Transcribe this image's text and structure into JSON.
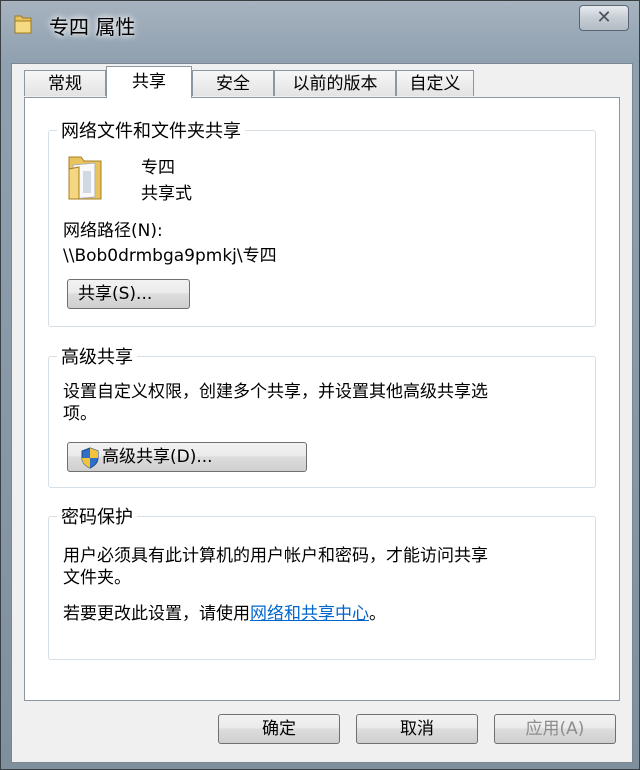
{
  "window": {
    "title": "专四 属性",
    "close_glyph": "✕"
  },
  "tabs": [
    {
      "label": "常规"
    },
    {
      "label": "共享"
    },
    {
      "label": "安全"
    },
    {
      "label": "以前的版本"
    },
    {
      "label": "自定义"
    }
  ],
  "network_sharing": {
    "group_title": "网络文件和文件夹共享",
    "folder_name": "专四",
    "status": "共享式",
    "path_label": "网络路径(N):",
    "path_value": "\\\\Bob0drmbga9pmkj\\专四",
    "share_button": "共享(S)..."
  },
  "advanced_sharing": {
    "group_title": "高级共享",
    "description": "设置自定义权限，创建多个共享，并设置其他高级共享选项。",
    "description_line1": "设置自定义权限，创建多个共享，并设置其他高级共享选",
    "description_line2": "项。",
    "button": "高级共享(D)...",
    "button_icon": "uac-shield-icon"
  },
  "password_protection": {
    "group_title": "密码保护",
    "line1": "用户必须具有此计算机的用户帐户和密码，才能访问共享",
    "line2": "文件夹。",
    "change_prefix": "若要更改此设置，请使用",
    "link_text": "网络和共享中心",
    "change_suffix": "。"
  },
  "footer": {
    "ok": "确定",
    "cancel": "取消",
    "apply": "应用(A)"
  },
  "colors": {
    "link": "#0066cc",
    "disabled_text": "#8d8d8d"
  }
}
